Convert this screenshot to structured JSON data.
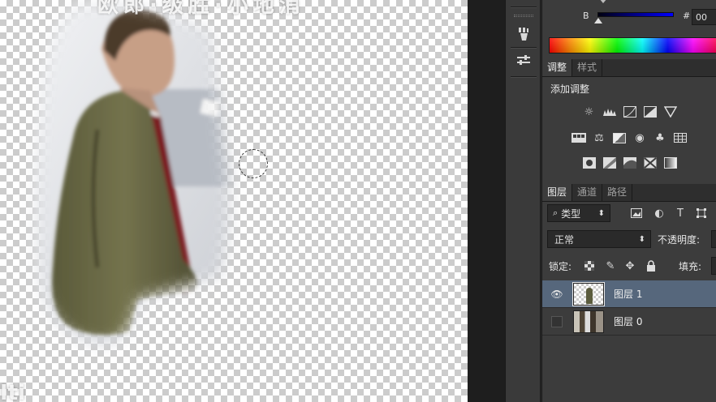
{
  "canvas": {
    "overlay_text": "欧郎·级胜·小地消",
    "corner_text": "Iti"
  },
  "toolbar": {
    "tools": [
      {
        "icon": "brush-presets-icon"
      },
      {
        "icon": "tool-presets-icon"
      }
    ]
  },
  "color_panel": {
    "b_label": "B",
    "hash": "#",
    "hex_value": "00"
  },
  "adjust_panel": {
    "tabs": [
      {
        "label": "调整",
        "active": true
      },
      {
        "label": "样式",
        "active": false
      }
    ],
    "title": "添加调整",
    "icon_rows": [
      [
        "brightness-contrast-icon",
        "levels-icon",
        "curves-icon",
        "exposure-icon",
        "gradient-triangle-icon"
      ],
      [
        "vibrance-icon",
        "balance-icon",
        "black-white-icon",
        "photo-filter-icon",
        "channel-mixer-icon",
        "color-lookup-icon"
      ],
      [
        "invert-icon",
        "posterize-icon",
        "threshold-icon",
        "selective-color-icon",
        "gradient-map-icon"
      ]
    ]
  },
  "layers_panel": {
    "tabs": [
      {
        "label": "图层",
        "active": true
      },
      {
        "label": "通道",
        "active": false
      },
      {
        "label": "路径",
        "active": false
      }
    ],
    "filter_label": "类型",
    "blend_mode": "正常",
    "opacity_label": "不透明度:",
    "lock_label": "锁定:",
    "fill_label": "填充:",
    "layers": [
      {
        "name": "图层 1",
        "visible": true,
        "selected": true,
        "thumb": "transparent"
      },
      {
        "name": "图层 0",
        "visible": false,
        "selected": false,
        "thumb": "photo"
      }
    ]
  }
}
